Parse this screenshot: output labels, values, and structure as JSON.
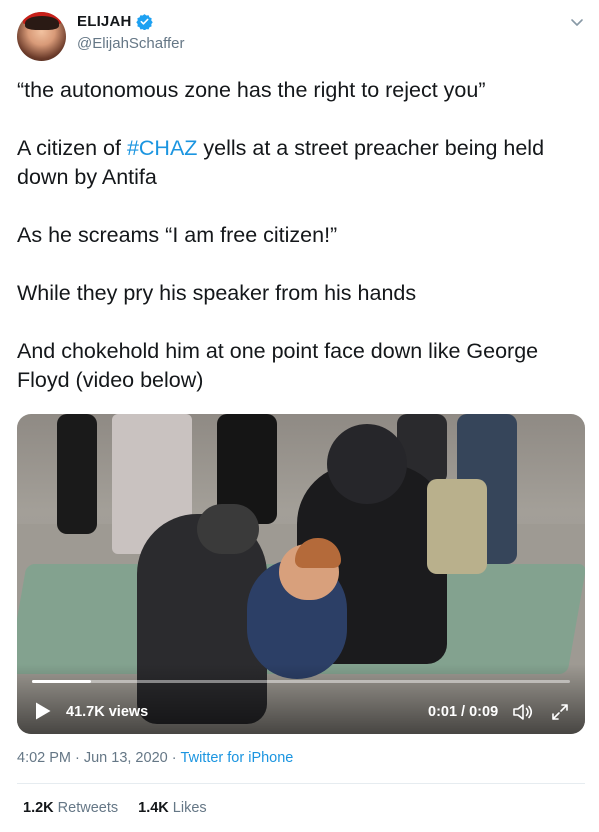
{
  "author": {
    "display_name": "ELIJAH",
    "handle": "@ElijahSchaffer",
    "verified": true
  },
  "tweet": {
    "lines": [
      [
        "“the autonomous zone has the right to reject you”"
      ],
      [
        "A citizen of ",
        "#CHAZ",
        " yells at a street preacher being held down by Antifa"
      ],
      [
        "As he screams “I am free citizen!”"
      ],
      [
        "While they pry his speaker from his hands"
      ],
      [
        "And chokehold him at one point face down like George Floyd (video below)"
      ]
    ],
    "hashtag": "#CHAZ"
  },
  "video": {
    "views": "41.7K views",
    "time": "0:01 / 0:09",
    "progress": 0.11
  },
  "meta": {
    "time": "4:02 PM",
    "date": "Jun 13, 2020",
    "separator": "·",
    "source": "Twitter for iPhone"
  },
  "stats": {
    "retweets_count": "1.2K",
    "retweets_label": "Retweets",
    "likes_count": "1.4K",
    "likes_label": "Likes"
  },
  "colors": {
    "link": "#1b95e0",
    "secondary_text": "#657786",
    "primary_text": "#14171a"
  }
}
